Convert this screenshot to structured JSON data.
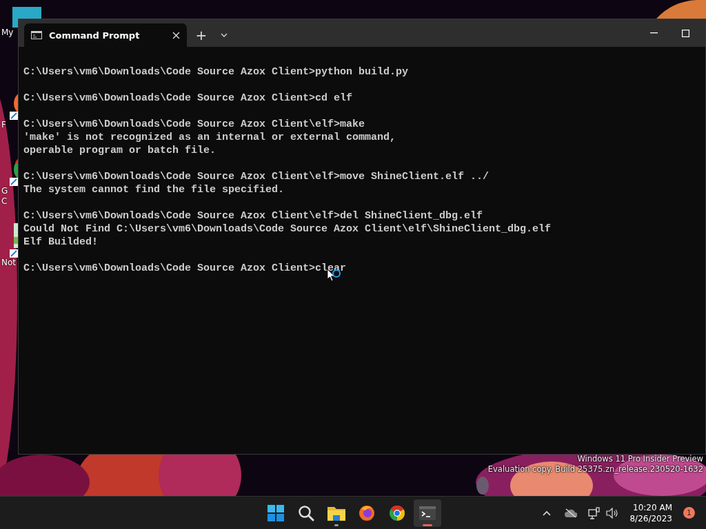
{
  "desktop_icons": [
    {
      "kind": "computer",
      "label": "My"
    },
    {
      "kind": "firefox",
      "label": "F"
    },
    {
      "kind": "chrome",
      "label": "G\nC"
    },
    {
      "kind": "notepad",
      "label": "Not"
    }
  ],
  "window": {
    "tab": {
      "title": "Command Prompt",
      "selected": true
    },
    "new_tab": "+"
  },
  "terminal": {
    "blocks": [
      [
        "C:\\Users\\vm6\\Downloads\\Code Source Azox Client>python build.py"
      ],
      [
        "C:\\Users\\vm6\\Downloads\\Code Source Azox Client>cd elf"
      ],
      [
        "C:\\Users\\vm6\\Downloads\\Code Source Azox Client\\elf>make",
        "'make' is not recognized as an internal or external command,",
        "operable program or batch file."
      ],
      [
        "C:\\Users\\vm6\\Downloads\\Code Source Azox Client\\elf>move ShineClient.elf ../",
        "The system cannot find the file specified."
      ],
      [
        "C:\\Users\\vm6\\Downloads\\Code Source Azox Client\\elf>del ShineClient_dbg.elf",
        "Could Not Find C:\\Users\\vm6\\Downloads\\Code Source Azox Client\\elf\\ShineClient_dbg.elf",
        "Elf Builded!"
      ],
      [
        "C:\\Users\\vm6\\Downloads\\Code Source Azox Client>clear"
      ]
    ]
  },
  "edition": [
    "Windows 11 Pro Insider Preview",
    "Evaluation copy. Build 25375.zn_release.230520-1632"
  ],
  "taskbar": {
    "apps": [
      {
        "kind": "start",
        "running": false,
        "selected": false
      },
      {
        "kind": "search",
        "running": false,
        "selected": false
      },
      {
        "kind": "explorer",
        "running": true,
        "selected": false
      },
      {
        "kind": "firefox",
        "running": false,
        "selected": false
      },
      {
        "kind": "chrome",
        "running": false,
        "selected": false
      },
      {
        "kind": "terminal",
        "running": true,
        "selected": true
      }
    ],
    "time": "10:20 AM",
    "date": "8/26/2023",
    "notifications": "1"
  }
}
